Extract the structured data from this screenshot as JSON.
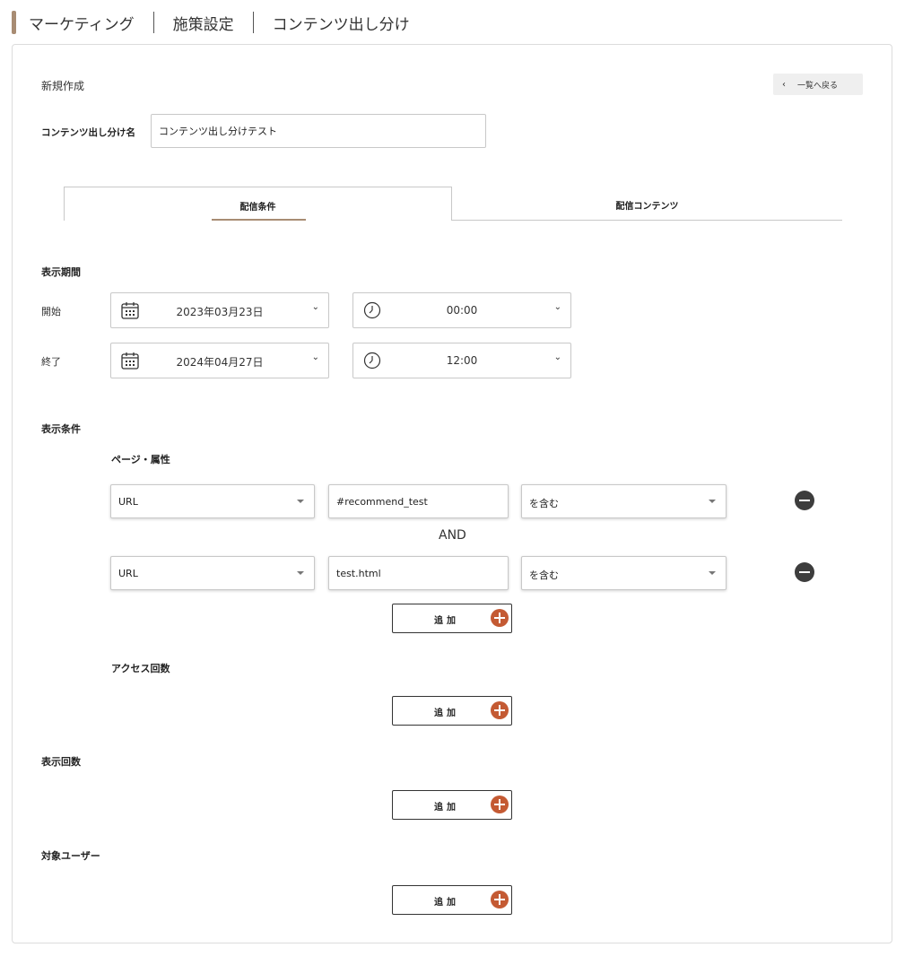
{
  "breadcrumb": {
    "items": [
      "マーケティング",
      "施策設定",
      "コンテンツ出し分け"
    ]
  },
  "page": {
    "title": "新規作成",
    "back_label": "一覧へ戻る"
  },
  "name_field": {
    "label": "コンテンツ出し分け名",
    "value": "コンテンツ出し分けテスト"
  },
  "tabs": [
    {
      "label": "配信条件",
      "active": true
    },
    {
      "label": "配信コンテンツ",
      "active": false
    }
  ],
  "period": {
    "heading": "表示期間",
    "start": {
      "label": "開始",
      "date": "2023年03月23日",
      "time": "00:00"
    },
    "end": {
      "label": "終了",
      "date": "2024年04月27日",
      "time": "12:00"
    }
  },
  "conditions": {
    "heading": "表示条件",
    "page_attr": {
      "subheading": "ページ・属性",
      "rows": [
        {
          "field": "URL",
          "value": "#recommend_test",
          "operator": "を含む"
        },
        {
          "field": "URL",
          "value": "test.html",
          "operator": "を含む"
        }
      ],
      "joiner": "AND"
    },
    "access_count": {
      "subheading": "アクセス回数"
    }
  },
  "display_count": {
    "heading": "表示回数"
  },
  "target_users": {
    "heading": "対象ユーザー"
  },
  "add_label": "追加",
  "icons": {
    "calendar": "calendar-icon",
    "clock": "clock-icon",
    "chevron": "chevron-down-icon",
    "remove": "minus-circle-icon",
    "add": "plus-circle-icon"
  },
  "colors": {
    "accent": "#a88c73",
    "add_button": "#c45a33",
    "remove_button": "#3d3d3d"
  }
}
